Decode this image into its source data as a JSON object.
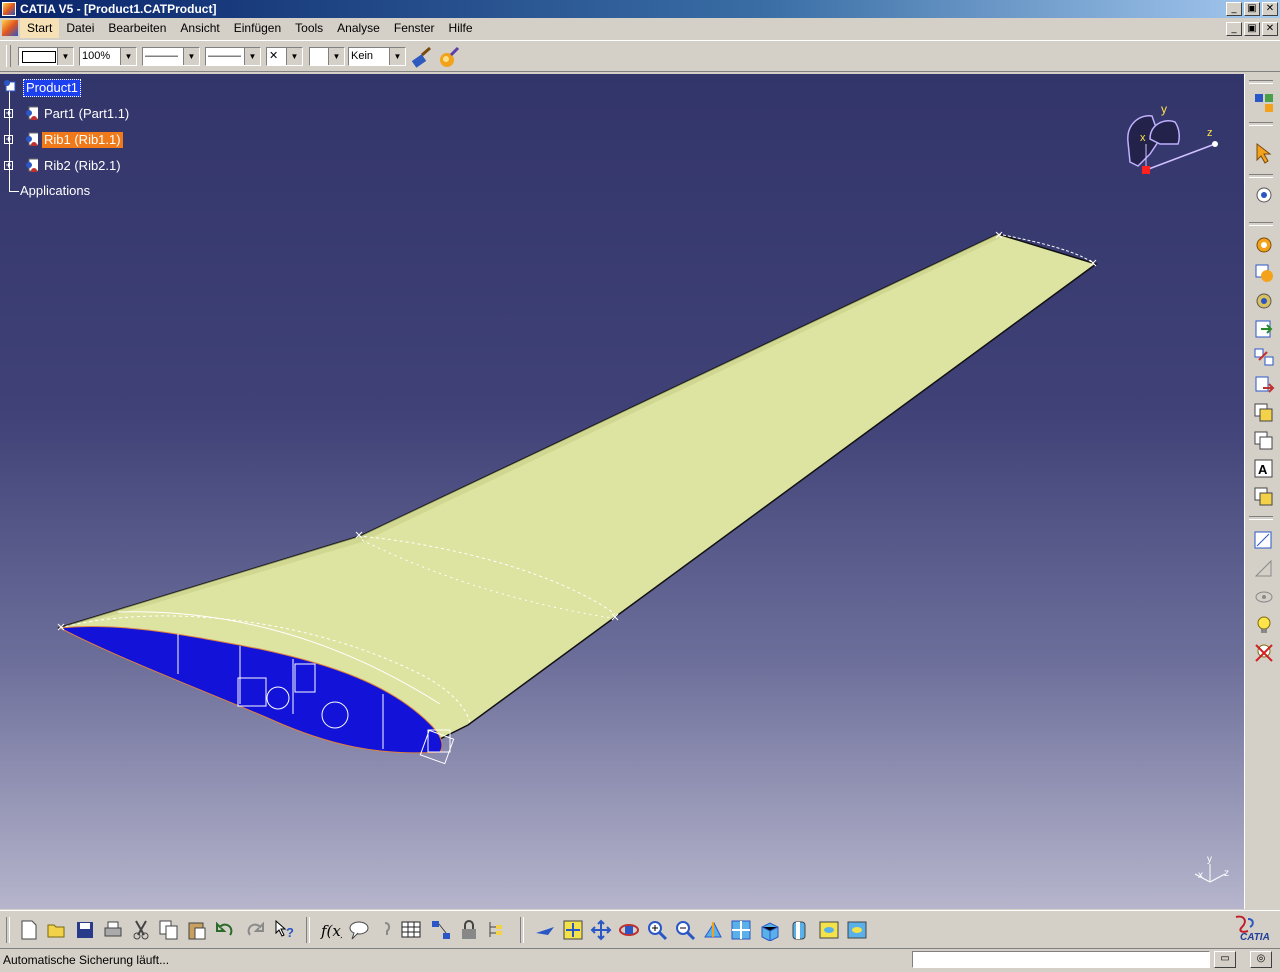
{
  "window": {
    "title": "CATIA V5 - [Product1.CATProduct]"
  },
  "window_controls": {
    "minimize": "_",
    "restore": "▣",
    "close": "✕"
  },
  "menu": {
    "items": [
      {
        "label": "Start"
      },
      {
        "label": "Datei"
      },
      {
        "label": "Bearbeiten"
      },
      {
        "label": "Ansicht"
      },
      {
        "label": "Einfügen"
      },
      {
        "label": "Tools"
      },
      {
        "label": "Analyse"
      },
      {
        "label": "Fenster"
      },
      {
        "label": "Hilfe"
      }
    ]
  },
  "top_toolbar": {
    "color_combo": "",
    "opacity_combo": "100%",
    "linetype_combo": "———",
    "lineweight_combo": "———",
    "point_combo": "✕",
    "layer_combo": "",
    "layer_name_combo": "Kein"
  },
  "tree": {
    "root": "Product1",
    "children": [
      {
        "label": "Part1 (Part1.1)"
      },
      {
        "label": "Rib1 (Rib1.1)"
      },
      {
        "label": "Rib2 (Rib2.1)"
      }
    ],
    "applications": "Applications"
  },
  "compass": {
    "x": "x",
    "y": "y",
    "z": "z"
  },
  "axis_triad": {
    "y": "y",
    "x": "x",
    "z": "z"
  },
  "status": {
    "message": "Automatische Sicherung läuft...",
    "input_value": ""
  },
  "brand": {
    "logo": "CATIA"
  },
  "colors": {
    "wing_surface": "#dde3a0",
    "rib_section": "#1212d8",
    "tree_selected": "#1c3ff0",
    "tree_highlight": "#f07a1a",
    "viewport_top": "#32356a",
    "viewport_bottom": "#b6b5cc"
  },
  "right_toolbar_icons": [
    "product-structure-icon",
    "select-arrow-icon",
    "view-icon",
    "gear-icon",
    "gear-icon-2",
    "gear-icon-3",
    "insert-existing-icon",
    "replace-icon",
    "move-icon",
    "copy-icon",
    "paste-icon",
    "text-icon",
    "layer-icon",
    "measure-icon",
    "measure-disabled-icon",
    "hide-show-icon",
    "light-bulb-icon",
    "no-show-icon"
  ],
  "bottom_toolbar_icons": [
    "new-icon",
    "open-icon",
    "save-icon",
    "print-icon",
    "cut-icon",
    "copy-icon",
    "paste-icon",
    "undo-icon",
    "redo-icon",
    "whats-this-icon",
    "formula-icon",
    "comment-icon",
    "knowledge-icon",
    "table-icon",
    "graph-icon",
    "lock-icon",
    "tree-icon",
    "fly-icon",
    "fit-all-icon",
    "pan-icon",
    "rotate-icon",
    "zoom-in-icon",
    "zoom-out-icon",
    "normal-view-icon",
    "multi-view-icon",
    "iso-view-icon",
    "shading-icon",
    "hide-icon",
    "swap-visible-icon"
  ]
}
